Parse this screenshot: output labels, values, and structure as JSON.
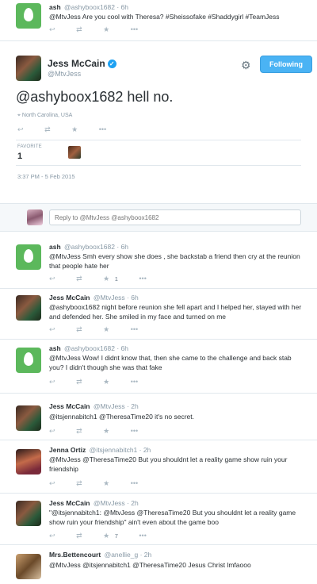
{
  "tweets": [
    {
      "name": "ash",
      "handle": "@ashyboox1682 · 6h",
      "text": "@MtvJess Are you cool with Theresa? #Sheissofake #Shaddygirl #TeamJess"
    },
    {
      "name": "ash",
      "handle": "@ashyboox1682 · 6h",
      "text": "@MtvJess Smh every show she does , she backstab a friend then cry at the reunion that people hate her",
      "fav_count": "1"
    },
    {
      "name": "Jess McCain",
      "handle": "@MtvJess · 6h",
      "text": "@ashyboox1682 night before reunion she fell apart and I helped her, stayed with her and defended her. She smiled in my face and turned on me"
    },
    {
      "name": "ash",
      "handle": "@ashyboox1682 · 6h",
      "text": "@MtvJess Wow! I didnt know that, then she came to the challenge and back stab you? I didn't though she was that fake"
    },
    {
      "name": "Jess McCain",
      "handle": "@MtvJess · 2h",
      "text": "@itsjennabitch1 @TheresaTime20 it's no secret."
    },
    {
      "name": "Jenna Ortiz",
      "handle": "@itsjennabitch1 · 2h",
      "text": "@MtvJess @TheresaTime20 But you shouldnt let a reality game show ruin your friendship"
    },
    {
      "name": "Jess McCain",
      "handle": "@MtvJess · 2h",
      "text": "\"@itsjennabitch1: @MtvJess @TheresaTime20 But you shouldnt let a reality game show ruin your friendship\" ain't even about the game boo",
      "fav_count": "7"
    },
    {
      "name": "Mrs.Bettencourt",
      "handle": "@anellie_g · 2h",
      "text": "@MtvJess @itsjennabitch1 @TheresaTime20 Jesus Christ lmfaooo"
    }
  ],
  "main_tweet": {
    "name": "Jess McCain",
    "handle": "@MtvJess",
    "text": "@ashyboox1682 hell no.",
    "location": "North Carolina, USA",
    "favorites_label": "FAVORITE",
    "favorites_count": "1",
    "timestamp": "3:37 PM - 5 Feb 2015",
    "follow_label": "Following"
  },
  "reply": {
    "placeholder": "Reply to @MtvJess @ashyboox1682"
  },
  "icons": {
    "reply": "↩",
    "retweet": "⇄",
    "favorite": "★",
    "more": "•••",
    "gear": "⚙",
    "location": "⌖",
    "verified": "✓"
  },
  "colors": {
    "accent": "#4ab3f4",
    "egg": "#5cb85c",
    "border": "#e1e8ed",
    "muted": "#8899a6"
  }
}
